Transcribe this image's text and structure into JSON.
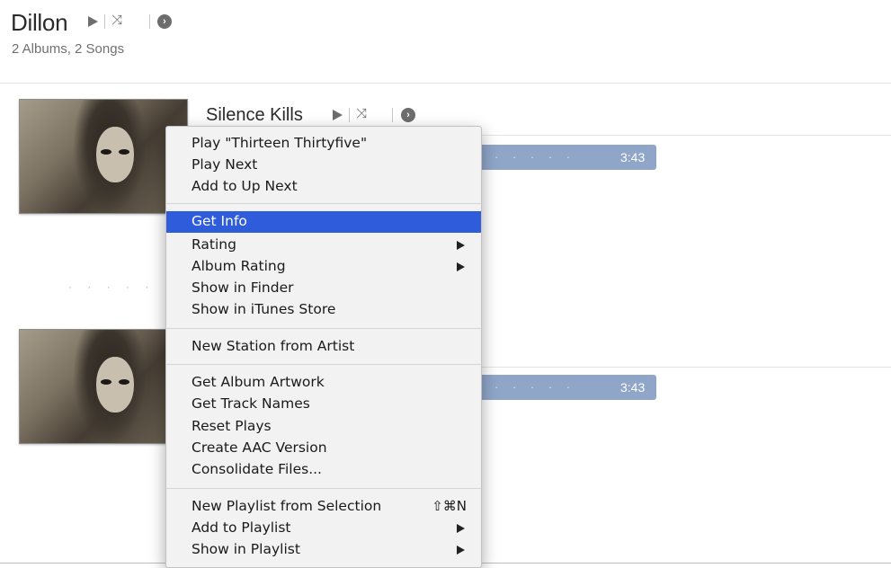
{
  "header": {
    "artist": "Dillon",
    "summary": "2 Albums, 2 Songs",
    "controls": {
      "play_icon": "play-icon",
      "shuffle_icon": "shuffle-icon",
      "more_icon": "more-options-icon"
    }
  },
  "album": {
    "title": "Silence Kills",
    "controls": {
      "play_icon": "play-icon",
      "shuffle_icon": "shuffle-icon",
      "more_icon": "more-options-icon"
    }
  },
  "tracks": [
    {
      "dots": "· · · · ·",
      "duration": "3:43"
    },
    {
      "dots": "· · · · ·",
      "duration": "3:43"
    }
  ],
  "left_dots": "· · · · ·",
  "colors": {
    "menu_highlight": "#2f5cdb",
    "track_selected": "#8fa6c9"
  },
  "context_menu": {
    "groups": [
      {
        "items": [
          {
            "label": "Play \"Thirteen Thirtyfive\""
          },
          {
            "label": "Play Next"
          },
          {
            "label": "Add to Up Next"
          }
        ]
      },
      {
        "items": [
          {
            "label": "Get Info",
            "highlighted": true
          },
          {
            "label": "Rating",
            "submenu": true
          },
          {
            "label": "Album Rating",
            "submenu": true
          },
          {
            "label": "Show in Finder"
          },
          {
            "label": "Show in iTunes Store"
          }
        ]
      },
      {
        "items": [
          {
            "label": "New Station from Artist"
          }
        ]
      },
      {
        "items": [
          {
            "label": "Get Album Artwork"
          },
          {
            "label": "Get Track Names"
          },
          {
            "label": "Reset Plays"
          },
          {
            "label": "Create AAC Version"
          },
          {
            "label": "Consolidate Files..."
          }
        ]
      },
      {
        "items": [
          {
            "label": "New Playlist from Selection",
            "shortcut": "⇧⌘N"
          },
          {
            "label": "Add to Playlist",
            "submenu": true
          },
          {
            "label": "Show in Playlist",
            "submenu": true
          }
        ]
      }
    ]
  }
}
